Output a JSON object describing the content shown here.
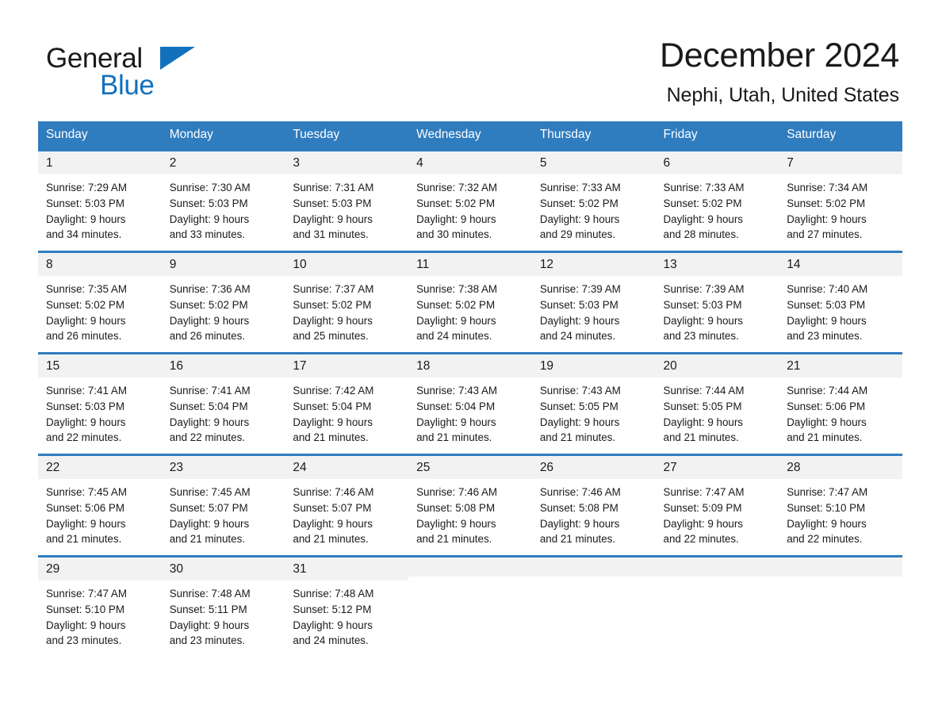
{
  "logo": {
    "word_one": "General",
    "word_two": "Blue",
    "triangle_color": "#1271bd",
    "blue_color": "#1271bd"
  },
  "header": {
    "title": "December 2024",
    "location": "Nephi, Utah, United States"
  },
  "theme": {
    "header_blue": "#2f7cbf",
    "row_divider_blue": "#2f7cbf",
    "daynum_band": "#f2f2f2",
    "text": "#1a1a1a",
    "page_background": "#ffffff"
  },
  "calendar": {
    "weekday_headers": [
      "Sunday",
      "Monday",
      "Tuesday",
      "Wednesday",
      "Thursday",
      "Friday",
      "Saturday"
    ],
    "weeks": [
      [
        {
          "day": "1",
          "sunrise": "Sunrise: 7:29 AM",
          "sunset": "Sunset: 5:03 PM",
          "daylight_1": "Daylight: 9 hours",
          "daylight_2": "and 34 minutes."
        },
        {
          "day": "2",
          "sunrise": "Sunrise: 7:30 AM",
          "sunset": "Sunset: 5:03 PM",
          "daylight_1": "Daylight: 9 hours",
          "daylight_2": "and 33 minutes."
        },
        {
          "day": "3",
          "sunrise": "Sunrise: 7:31 AM",
          "sunset": "Sunset: 5:03 PM",
          "daylight_1": "Daylight: 9 hours",
          "daylight_2": "and 31 minutes."
        },
        {
          "day": "4",
          "sunrise": "Sunrise: 7:32 AM",
          "sunset": "Sunset: 5:02 PM",
          "daylight_1": "Daylight: 9 hours",
          "daylight_2": "and 30 minutes."
        },
        {
          "day": "5",
          "sunrise": "Sunrise: 7:33 AM",
          "sunset": "Sunset: 5:02 PM",
          "daylight_1": "Daylight: 9 hours",
          "daylight_2": "and 29 minutes."
        },
        {
          "day": "6",
          "sunrise": "Sunrise: 7:33 AM",
          "sunset": "Sunset: 5:02 PM",
          "daylight_1": "Daylight: 9 hours",
          "daylight_2": "and 28 minutes."
        },
        {
          "day": "7",
          "sunrise": "Sunrise: 7:34 AM",
          "sunset": "Sunset: 5:02 PM",
          "daylight_1": "Daylight: 9 hours",
          "daylight_2": "and 27 minutes."
        }
      ],
      [
        {
          "day": "8",
          "sunrise": "Sunrise: 7:35 AM",
          "sunset": "Sunset: 5:02 PM",
          "daylight_1": "Daylight: 9 hours",
          "daylight_2": "and 26 minutes."
        },
        {
          "day": "9",
          "sunrise": "Sunrise: 7:36 AM",
          "sunset": "Sunset: 5:02 PM",
          "daylight_1": "Daylight: 9 hours",
          "daylight_2": "and 26 minutes."
        },
        {
          "day": "10",
          "sunrise": "Sunrise: 7:37 AM",
          "sunset": "Sunset: 5:02 PM",
          "daylight_1": "Daylight: 9 hours",
          "daylight_2": "and 25 minutes."
        },
        {
          "day": "11",
          "sunrise": "Sunrise: 7:38 AM",
          "sunset": "Sunset: 5:02 PM",
          "daylight_1": "Daylight: 9 hours",
          "daylight_2": "and 24 minutes."
        },
        {
          "day": "12",
          "sunrise": "Sunrise: 7:39 AM",
          "sunset": "Sunset: 5:03 PM",
          "daylight_1": "Daylight: 9 hours",
          "daylight_2": "and 24 minutes."
        },
        {
          "day": "13",
          "sunrise": "Sunrise: 7:39 AM",
          "sunset": "Sunset: 5:03 PM",
          "daylight_1": "Daylight: 9 hours",
          "daylight_2": "and 23 minutes."
        },
        {
          "day": "14",
          "sunrise": "Sunrise: 7:40 AM",
          "sunset": "Sunset: 5:03 PM",
          "daylight_1": "Daylight: 9 hours",
          "daylight_2": "and 23 minutes."
        }
      ],
      [
        {
          "day": "15",
          "sunrise": "Sunrise: 7:41 AM",
          "sunset": "Sunset: 5:03 PM",
          "daylight_1": "Daylight: 9 hours",
          "daylight_2": "and 22 minutes."
        },
        {
          "day": "16",
          "sunrise": "Sunrise: 7:41 AM",
          "sunset": "Sunset: 5:04 PM",
          "daylight_1": "Daylight: 9 hours",
          "daylight_2": "and 22 minutes."
        },
        {
          "day": "17",
          "sunrise": "Sunrise: 7:42 AM",
          "sunset": "Sunset: 5:04 PM",
          "daylight_1": "Daylight: 9 hours",
          "daylight_2": "and 21 minutes."
        },
        {
          "day": "18",
          "sunrise": "Sunrise: 7:43 AM",
          "sunset": "Sunset: 5:04 PM",
          "daylight_1": "Daylight: 9 hours",
          "daylight_2": "and 21 minutes."
        },
        {
          "day": "19",
          "sunrise": "Sunrise: 7:43 AM",
          "sunset": "Sunset: 5:05 PM",
          "daylight_1": "Daylight: 9 hours",
          "daylight_2": "and 21 minutes."
        },
        {
          "day": "20",
          "sunrise": "Sunrise: 7:44 AM",
          "sunset": "Sunset: 5:05 PM",
          "daylight_1": "Daylight: 9 hours",
          "daylight_2": "and 21 minutes."
        },
        {
          "day": "21",
          "sunrise": "Sunrise: 7:44 AM",
          "sunset": "Sunset: 5:06 PM",
          "daylight_1": "Daylight: 9 hours",
          "daylight_2": "and 21 minutes."
        }
      ],
      [
        {
          "day": "22",
          "sunrise": "Sunrise: 7:45 AM",
          "sunset": "Sunset: 5:06 PM",
          "daylight_1": "Daylight: 9 hours",
          "daylight_2": "and 21 minutes."
        },
        {
          "day": "23",
          "sunrise": "Sunrise: 7:45 AM",
          "sunset": "Sunset: 5:07 PM",
          "daylight_1": "Daylight: 9 hours",
          "daylight_2": "and 21 minutes."
        },
        {
          "day": "24",
          "sunrise": "Sunrise: 7:46 AM",
          "sunset": "Sunset: 5:07 PM",
          "daylight_1": "Daylight: 9 hours",
          "daylight_2": "and 21 minutes."
        },
        {
          "day": "25",
          "sunrise": "Sunrise: 7:46 AM",
          "sunset": "Sunset: 5:08 PM",
          "daylight_1": "Daylight: 9 hours",
          "daylight_2": "and 21 minutes."
        },
        {
          "day": "26",
          "sunrise": "Sunrise: 7:46 AM",
          "sunset": "Sunset: 5:08 PM",
          "daylight_1": "Daylight: 9 hours",
          "daylight_2": "and 21 minutes."
        },
        {
          "day": "27",
          "sunrise": "Sunrise: 7:47 AM",
          "sunset": "Sunset: 5:09 PM",
          "daylight_1": "Daylight: 9 hours",
          "daylight_2": "and 22 minutes."
        },
        {
          "day": "28",
          "sunrise": "Sunrise: 7:47 AM",
          "sunset": "Sunset: 5:10 PM",
          "daylight_1": "Daylight: 9 hours",
          "daylight_2": "and 22 minutes."
        }
      ],
      [
        {
          "day": "29",
          "sunrise": "Sunrise: 7:47 AM",
          "sunset": "Sunset: 5:10 PM",
          "daylight_1": "Daylight: 9 hours",
          "daylight_2": "and 23 minutes."
        },
        {
          "day": "30",
          "sunrise": "Sunrise: 7:48 AM",
          "sunset": "Sunset: 5:11 PM",
          "daylight_1": "Daylight: 9 hours",
          "daylight_2": "and 23 minutes."
        },
        {
          "day": "31",
          "sunrise": "Sunrise: 7:48 AM",
          "sunset": "Sunset: 5:12 PM",
          "daylight_1": "Daylight: 9 hours",
          "daylight_2": "and 24 minutes."
        },
        {
          "day": "",
          "sunrise": "",
          "sunset": "",
          "daylight_1": "",
          "daylight_2": ""
        },
        {
          "day": "",
          "sunrise": "",
          "sunset": "",
          "daylight_1": "",
          "daylight_2": ""
        },
        {
          "day": "",
          "sunrise": "",
          "sunset": "",
          "daylight_1": "",
          "daylight_2": ""
        },
        {
          "day": "",
          "sunrise": "",
          "sunset": "",
          "daylight_1": "",
          "daylight_2": ""
        }
      ]
    ]
  }
}
